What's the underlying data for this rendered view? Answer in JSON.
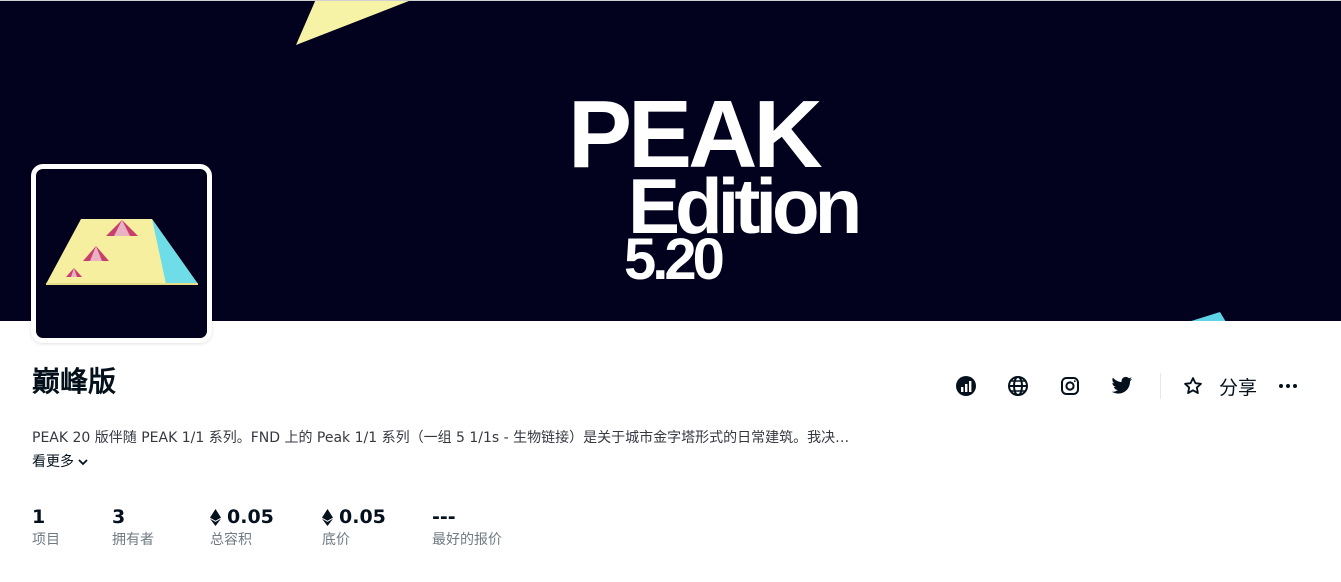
{
  "collection": {
    "name": "巅峰版",
    "description": "PEAK 20 版伴随 PEAK 1/1 系列。FND 上的 Peak 1/1 系列（一组 5 1/1s - 生物链接）是关于城市金字塔形式的日常建筑。我决…",
    "see_more_label": "看更多"
  },
  "banner": {
    "line1": "PEAK",
    "line2": "Edition",
    "line3": "5.20",
    "background_color": "#02021f"
  },
  "actions": {
    "share_label": "分享",
    "icons": [
      "activity-icon",
      "globe-icon",
      "instagram-icon",
      "twitter-icon",
      "star-icon",
      "more-icon"
    ]
  },
  "stats": [
    {
      "value": "1",
      "label": "项目",
      "eth": false
    },
    {
      "value": "3",
      "label": "拥有者",
      "eth": false
    },
    {
      "value": "0.05",
      "label": "总容积",
      "eth": true
    },
    {
      "value": "0.05",
      "label": "底价",
      "eth": true
    },
    {
      "value": "---",
      "label": "最好的报价",
      "eth": false
    }
  ]
}
